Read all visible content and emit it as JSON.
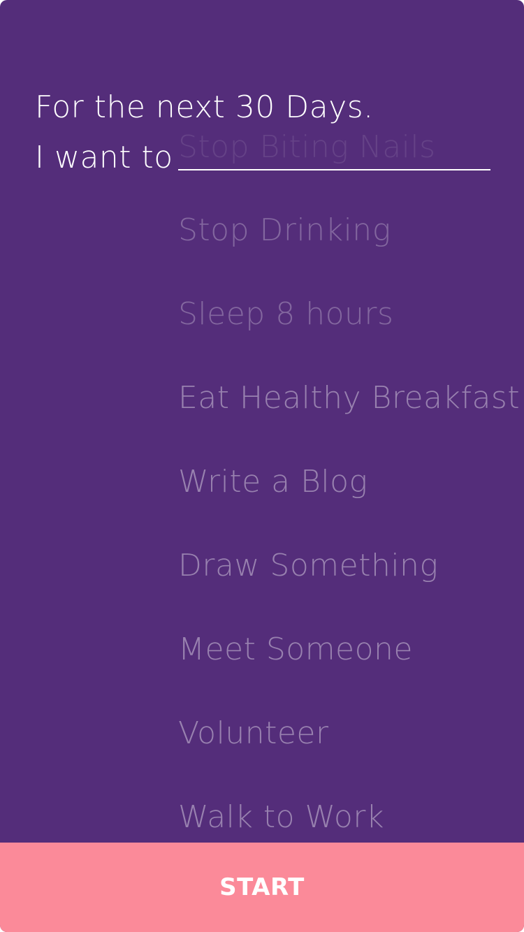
{
  "heading": {
    "line1": "For the next 30 Days.",
    "line2": "I want to"
  },
  "goal_input": {
    "placeholder": "Stop Biting Nails",
    "value": ""
  },
  "suggestions": [
    "Stop Drinking",
    "Sleep 8 hours",
    "Eat Healthy Breakfast",
    "Write a Blog",
    "Draw Something",
    "Meet Someone",
    "Volunteer",
    "Walk to Work"
  ],
  "start_button": {
    "label": "START"
  },
  "colors": {
    "background": "#542d7a",
    "accent": "#fb8a99",
    "text": "#ffffff"
  }
}
